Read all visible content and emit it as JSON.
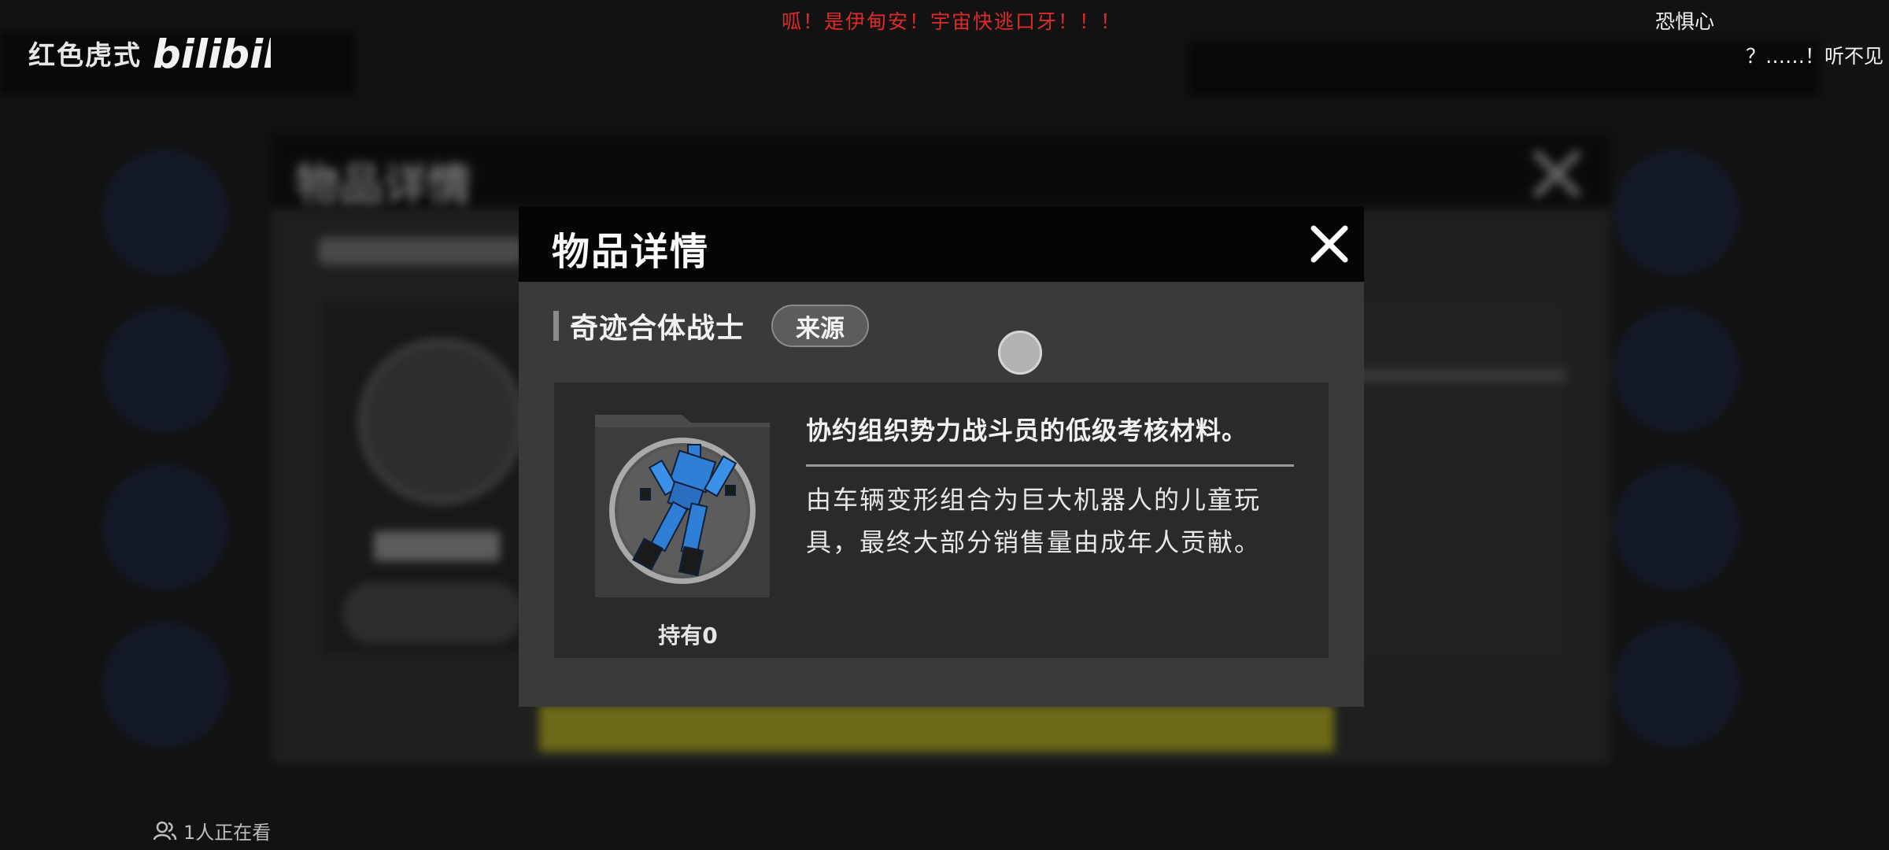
{
  "watermark": {
    "channel": "红色虎式",
    "logo": "bilibili"
  },
  "danmaku": {
    "red": "呱！是伊甸安！宇宙快逃口牙！！！",
    "white1": "恐惧心",
    "white2": "？……！听不见"
  },
  "viewers": {
    "icon": "viewers-icon",
    "label": "1人正在看"
  },
  "dialog": {
    "title": "物品详情",
    "close_icon": "close-icon",
    "item_name": "奇迹合体战士",
    "source_button": "来源",
    "held_label": "持有0",
    "description_short": "协约组织势力战斗员的低级考核材料。",
    "description_long": "由车辆变形组合为巨大机器人的儿童玩具，最终大部分销售量由成年人贡献。",
    "item_icon": "robot-toy-icon"
  },
  "colors": {
    "danmaku_red": "#e02a2a",
    "dialog_bg": "#3a3a3a",
    "dialog_header": "#050505",
    "robot_blue": "#2f7fd6",
    "bg_yellow": "#b8b31c"
  }
}
